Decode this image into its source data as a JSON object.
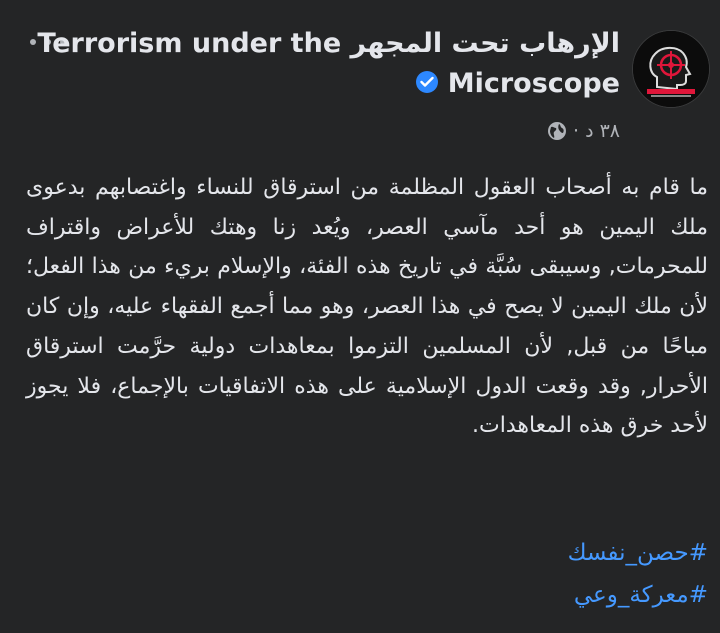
{
  "post": {
    "author_name_ar": "الإرهاب تحت المجهر",
    "author_name_en_line1": "Terrorism under the",
    "author_name_en_line2": "Microscope",
    "verified": true,
    "timestamp": "٣٨ د",
    "separator": "·",
    "audience_icon": "globe-icon",
    "body": "ما قام به أصحاب العقول المظلمة من استرقاق للنساء واغتصابهم بدعوى ملك اليمين هو أحد مآسي العصر، ويُعد زنا وهتك للأعراض واقتراف للمحرمات, وسيبقى سُبَّة في تاريخ هذه الفئة، والإسلام بريء من هذا الفعل؛ لأن ملك اليمين لا يصح في هذا العصر، وهو مما أجمع الفقهاء عليه، وإن كان مباحًا من قبل, لأن المسلمين التزموا بمعاهدات دولية حرَّمت استرقاق الأحرار, وقد وقعت الدول الإسلامية على هذه الاتفاقيات بالإجماع، فلا يجوز لأحد خرق هذه المعاهدات.",
    "hashtags": [
      "#حصن_نفسك",
      "#معركة_وعي"
    ]
  },
  "colors": {
    "background": "#242526",
    "text": "#e4e6eb",
    "secondary_text": "#b0b3b8",
    "link": "#4599ff",
    "verified_badge": "#2d88ff",
    "avatar_accent": "#e0163a"
  },
  "icons": {
    "more": "more-options-icon",
    "verified": "verified-badge-icon",
    "audience": "globe-icon"
  }
}
